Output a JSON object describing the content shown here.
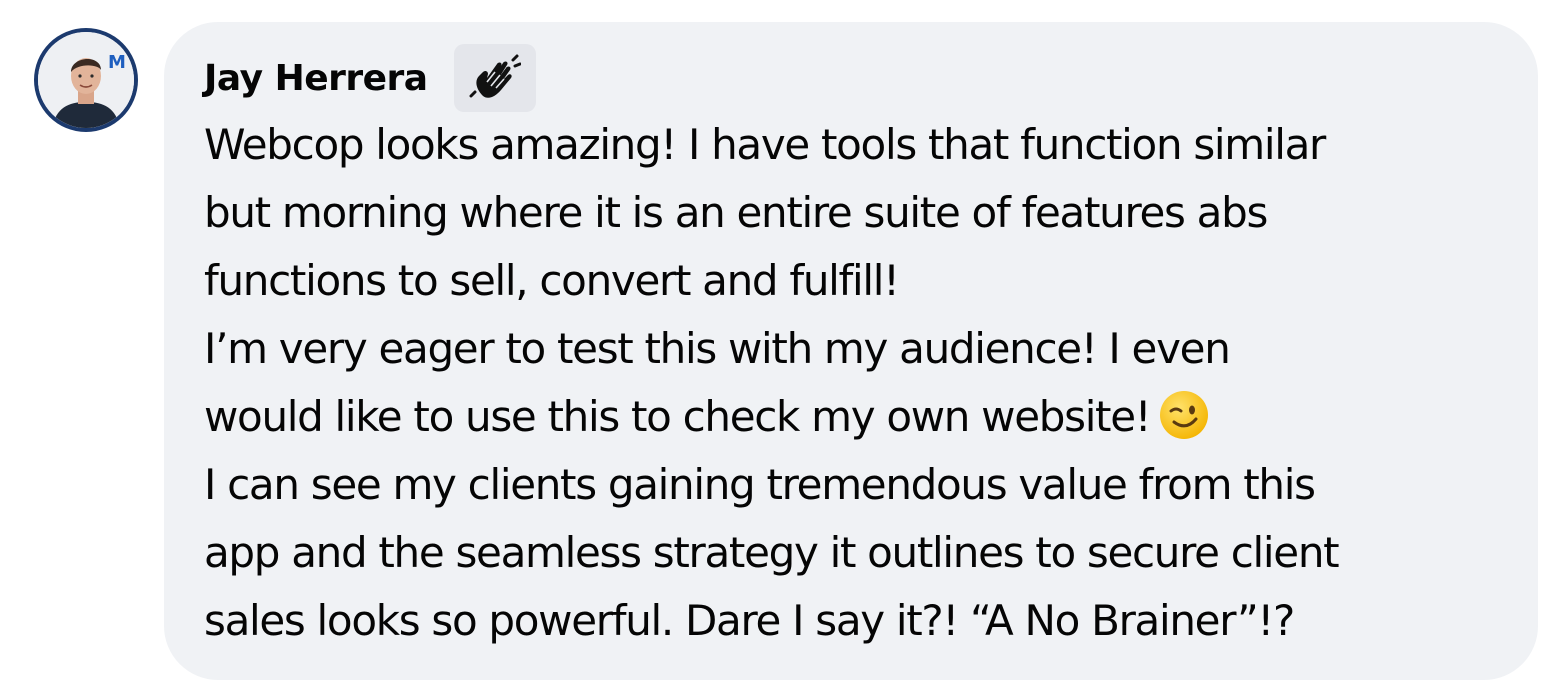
{
  "comment": {
    "author": {
      "name": "Jay Herrera",
      "avatar_icon": "avatar-photo",
      "badge_icon": "waving-hand-icon"
    },
    "lines": [
      "Webcop looks amazing! I have tools that function similar",
      "but morning where it is an entire suite of features abs",
      "functions to sell, convert and fulfill!",
      "I’m very eager to test this with my audience! I even",
      "would like to use this to check my own website!",
      "I can see my clients gaining tremendous value from this",
      "app and the seamless strategy it outlines to secure client",
      "sales looks so powerful. Dare I say it?! “A No Brainer”!?"
    ],
    "emoji_after_line_5": "winking-face-emoji"
  },
  "colors": {
    "bubble_background": "#f0f2f5",
    "badge_background": "#e4e6eb",
    "text": "#050505",
    "avatar_ring": "#1c3a6e"
  }
}
